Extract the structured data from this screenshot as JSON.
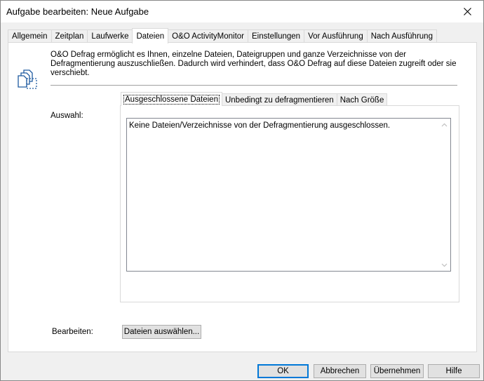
{
  "window": {
    "title": "Aufgabe bearbeiten: Neue Aufgabe"
  },
  "tabs": [
    {
      "label": "Allgemein"
    },
    {
      "label": "Zeitplan"
    },
    {
      "label": "Laufwerke"
    },
    {
      "label": "Dateien",
      "active": true
    },
    {
      "label": "O&O ActivityMonitor"
    },
    {
      "label": "Einstellungen"
    },
    {
      "label": "Vor Ausführung"
    },
    {
      "label": "Nach Ausführung"
    }
  ],
  "page": {
    "description": "O&O Defrag ermöglicht es Ihnen, einzelne Dateien, Dateigruppen und ganze Verzeichnisse von der Defragmentierung auszuschließen. Dadurch wird verhindert, dass O&O Defrag auf diese Dateien zugreift oder sie verschiebt.",
    "auswahl_label": "Auswahl:",
    "inner_tabs": [
      {
        "label": "Ausgeschlossene Dateien",
        "active": true
      },
      {
        "label": "Unbedingt zu defragmentieren"
      },
      {
        "label": "Nach Größe"
      }
    ],
    "list_empty_text": "Keine Dateien/Verzeichnisse von der Defragmentierung ausgeschlossen.",
    "bearbeiten_label": "Bearbeiten:",
    "select_files_button": "Dateien auswählen..."
  },
  "footer": {
    "ok": "OK",
    "cancel": "Abbrechen",
    "apply": "Übernehmen",
    "help": "Hilfe"
  }
}
